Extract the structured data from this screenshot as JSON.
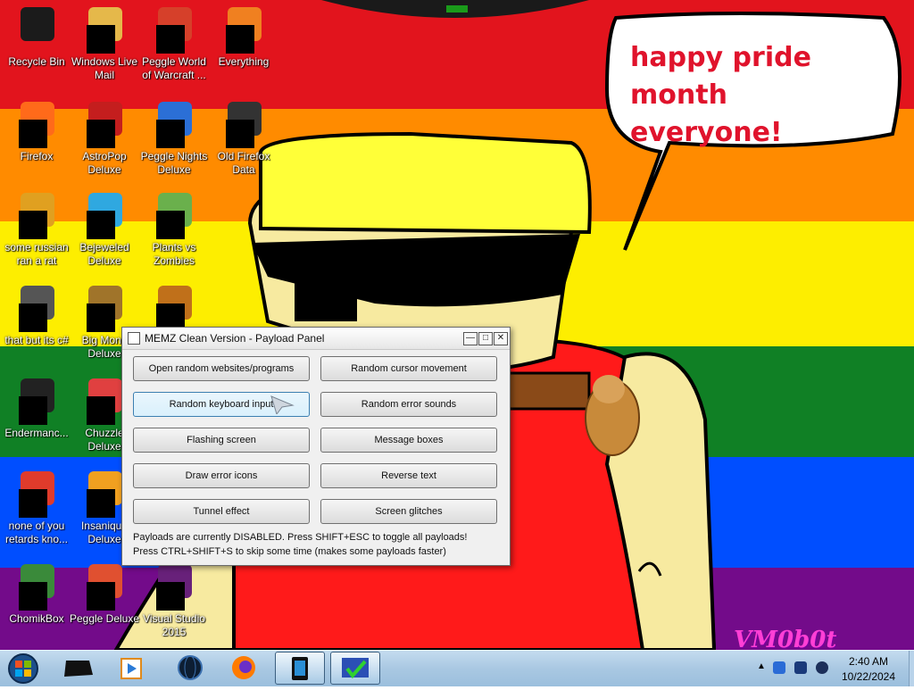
{
  "wallpaper": {
    "stripe_colors": [
      "#e2141d",
      "#ff8b00",
      "#fdee00",
      "#108025",
      "#004eff",
      "#730b8a"
    ],
    "bubble_text_line1": "happy pride month",
    "bubble_text_line2": "everyone!",
    "watermark": "VM0b0t"
  },
  "desktop_icons": [
    {
      "name": "recycle-bin",
      "label": "Recycle Bin",
      "color": "#1b1b1b"
    },
    {
      "name": "windows-live-mail",
      "label": "Windows Live Mail",
      "color": "#e5b84a"
    },
    {
      "name": "peggle-world-of-warcraft",
      "label": "Peggle World of Warcraft ...",
      "color": "#d6402a"
    },
    {
      "name": "everything",
      "label": "Everything",
      "color": "#f08020"
    },
    {
      "name": "firefox",
      "label": "Firefox",
      "color": "#ff6a1a"
    },
    {
      "name": "astropop-deluxe",
      "label": "AstroPop Deluxe",
      "color": "#c41e1e"
    },
    {
      "name": "peggle-nights-deluxe",
      "label": "Peggle Nights Deluxe",
      "color": "#2b6fd6"
    },
    {
      "name": "old-firefox-data",
      "label": "Old Firefox Data",
      "color": "#333333"
    },
    {
      "name": "some-russian-ran-a-rat",
      "label": "some russian ran a rat",
      "color": "#e0a020"
    },
    {
      "name": "bejeweled-deluxe",
      "label": "Bejeweled Deluxe",
      "color": "#2fa8e0"
    },
    {
      "name": "plants-vs-zombies",
      "label": "Plants vs Zombies",
      "color": "#6ab04c"
    },
    {
      "name": "that-but-its-csharp",
      "label": "that but its c#",
      "color": "#555555"
    },
    {
      "name": "big-money",
      "label": "Big Mone Deluxe",
      "color": "#a0742a"
    },
    {
      "name": "unnamed-game",
      "label": "",
      "color": "#c0701a"
    },
    {
      "name": "endermanc",
      "label": "Endermanc...",
      "color": "#222222"
    },
    {
      "name": "chuzzle-deluxe",
      "label": "Chuzzle Deluxe",
      "color": "#e04040"
    },
    {
      "name": "none-of-you-retards",
      "label": "none of you retards kno...",
      "color": "#e03b2b"
    },
    {
      "name": "insaniquarium-deluxe",
      "label": "Insaniqua Deluxe",
      "color": "#f0a020"
    },
    {
      "name": "chomikbox",
      "label": "ChomikBox",
      "color": "#3a8a3a"
    },
    {
      "name": "peggle-deluxe",
      "label": "Peggle Deluxe",
      "color": "#e05030"
    },
    {
      "name": "visual-studio-2015",
      "label": "Visual Studio 2015",
      "color": "#68217a"
    }
  ],
  "window": {
    "title": "MEMZ Clean Version - Payload Panel",
    "minimize": "—",
    "maximize": "□",
    "close": "✕",
    "buttons": [
      "Open random websites/programs",
      "Random cursor movement",
      "Random keyboard input",
      "Random error sounds",
      "Flashing screen",
      "Message boxes",
      "Draw error icons",
      "Reverse text",
      "Tunnel effect",
      "Screen glitches"
    ],
    "status_line1": "Payloads are currently DISABLED. Press SHIFT+ESC to toggle all payloads!",
    "status_line2": "Press CTRL+SHIFT+S to skip some time (makes some payloads faster)"
  },
  "taskbar": {
    "start_icon": "windows-orb-icon",
    "items": [
      {
        "name": "taskbar-item-black-app",
        "icon": "black-box-icon",
        "active": false
      },
      {
        "name": "taskbar-item-media-player",
        "icon": "media-player-icon",
        "active": false
      },
      {
        "name": "taskbar-item-globe",
        "icon": "globe-icon",
        "active": false
      },
      {
        "name": "taskbar-item-firefox",
        "icon": "firefox-icon",
        "active": false
      },
      {
        "name": "taskbar-item-device",
        "icon": "device-icon",
        "active": true
      },
      {
        "name": "taskbar-item-memz",
        "icon": "memz-icon",
        "active": true
      }
    ],
    "tray_arrow": "▲",
    "clock_time": "2:40 AM",
    "clock_date": "10/22/2024"
  }
}
